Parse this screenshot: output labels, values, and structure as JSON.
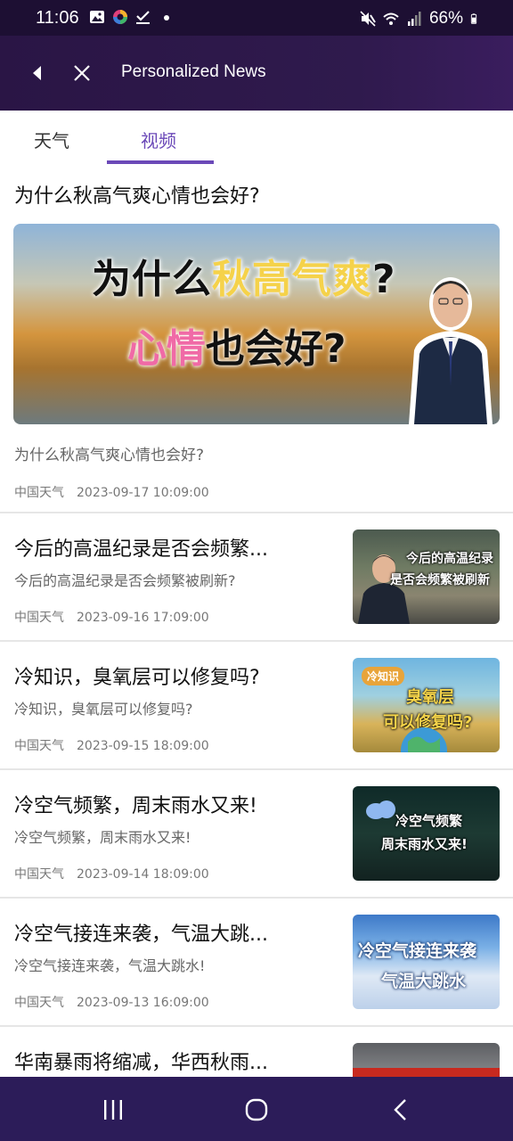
{
  "status_bar": {
    "time": "11:06",
    "battery": "66%",
    "left_icons": [
      "gallery-icon",
      "pinwheel-icon",
      "check-icon",
      "dot-icon"
    ],
    "right_icons": [
      "mute-icon",
      "wifi-icon",
      "signal-icon",
      "battery-icon"
    ]
  },
  "app_bar": {
    "title": "Personalized News"
  },
  "tabs": [
    {
      "label": "天气",
      "selected": false
    },
    {
      "label": "视频",
      "selected": true
    }
  ],
  "accent_color": "#6b49b8",
  "featured": {
    "title": "为什么秋高气爽心情也会好?",
    "image_text_line1_a": "为什么",
    "image_text_line1_b": "秋高气爽",
    "image_text_line1_c": "?",
    "image_text_line2_a": "心情",
    "image_text_line2_b": "也会好?",
    "description": "为什么秋高气爽心情也会好?",
    "source": "中国天气",
    "date": "2023-09-17 10:09:00"
  },
  "news": [
    {
      "title": "今后的高温纪录是否会频繁...",
      "description": "今后的高温纪录是否会频繁被刷新?",
      "source": "中国天气",
      "date": "2023-09-16 17:09:00",
      "thumb_caption_1": "今后的高温纪录",
      "thumb_caption_2": "是否会频繁被刷新"
    },
    {
      "title": "冷知识，臭氧层可以修复吗?",
      "description": "冷知识，臭氧层可以修复吗?",
      "source": "中国天气",
      "date": "2023-09-15 18:09:00",
      "thumb_caption_1": "冷知识",
      "thumb_caption_2": "臭氧层",
      "thumb_caption_3": "可以修复吗?"
    },
    {
      "title": "冷空气频繁，周末雨水又来!",
      "description": "冷空气频繁，周末雨水又来!",
      "source": "中国天气",
      "date": "2023-09-14 18:09:00",
      "thumb_caption_1": "冷空气频繁",
      "thumb_caption_2": "周末雨水又来!"
    },
    {
      "title": "冷空气接连来袭，气温大跳...",
      "description": "冷空气接连来袭，气温大跳水!",
      "source": "中国天气",
      "date": "2023-09-13 16:09:00",
      "thumb_caption_1": "冷空气接连来袭",
      "thumb_caption_2": "气温大跳水"
    },
    {
      "title": "华南暴雨将缩减，华西秋雨...",
      "description": "",
      "source": "",
      "date": "",
      "thumb_caption_1": ""
    }
  ],
  "nav_bar": {
    "buttons": [
      "recents-icon",
      "home-icon",
      "back-icon"
    ]
  }
}
